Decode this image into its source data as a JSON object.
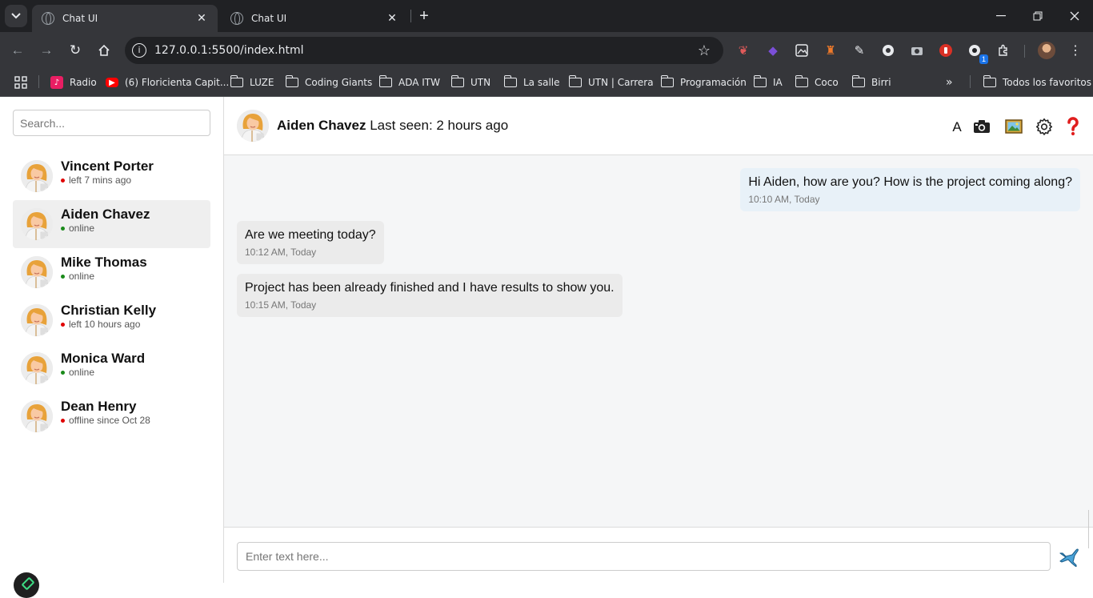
{
  "browser": {
    "tabs": [
      {
        "label": "Chat UI",
        "active": true
      },
      {
        "label": "Chat UI",
        "active": false
      }
    ],
    "url": "127.0.0.1:5500/index.html",
    "extension_badge": "1",
    "bookmarks": [
      {
        "label": "Radio",
        "icon": "radio-app-icon"
      },
      {
        "label": "(6) Floricienta Capit...",
        "icon": "youtube-icon"
      },
      {
        "label": "LUZE",
        "icon": "folder-icon"
      },
      {
        "label": "Coding Giants",
        "icon": "folder-icon"
      },
      {
        "label": "ADA ITW",
        "icon": "folder-icon"
      },
      {
        "label": "UTN",
        "icon": "folder-icon"
      },
      {
        "label": "La salle",
        "icon": "folder-icon"
      },
      {
        "label": "UTN | Carrera",
        "icon": "folder-icon"
      },
      {
        "label": "Programación",
        "icon": "folder-icon"
      },
      {
        "label": "IA",
        "icon": "folder-icon"
      },
      {
        "label": "Coco",
        "icon": "folder-icon"
      },
      {
        "label": "Birri",
        "icon": "folder-icon"
      }
    ],
    "all_bookmarks": "Todos los favoritos"
  },
  "sidebar": {
    "search_placeholder": "Search...",
    "contacts": [
      {
        "name": "Vincent Porter",
        "status": "left 7 mins ago",
        "status_color": "#e00000",
        "active": false
      },
      {
        "name": "Aiden Chavez",
        "status": "online",
        "status_color": "#1a8a1a",
        "active": true
      },
      {
        "name": "Mike Thomas",
        "status": "online",
        "status_color": "#1a8a1a",
        "active": false
      },
      {
        "name": "Christian Kelly",
        "status": "left 10 hours ago",
        "status_color": "#e00000",
        "active": false
      },
      {
        "name": "Monica Ward",
        "status": "online",
        "status_color": "#1a8a1a",
        "active": false
      },
      {
        "name": "Dean Henry",
        "status": "offline since Oct 28",
        "status_color": "#e00000",
        "active": false
      }
    ]
  },
  "chat": {
    "header": {
      "name": "Aiden Chavez",
      "last_seen": "Last seen: 2 hours ago",
      "font_button": "A"
    },
    "messages": [
      {
        "text": "Hi Aiden, how are you? How is the project coming along?",
        "time": "10:10 AM, Today",
        "direction": "out"
      },
      {
        "text": "Are we meeting today?",
        "time": "10:12 AM, Today",
        "direction": "in"
      },
      {
        "text": "Project has been already finished and I have results to show you.",
        "time": "10:15 AM, Today",
        "direction": "in"
      }
    ],
    "input_placeholder": "Enter text here..."
  },
  "colors": {
    "online": "#1a8a1a",
    "offline": "#e00000",
    "outgoing_bubble": "#e8f1f8",
    "incoming_bubble": "#ebebeb"
  }
}
